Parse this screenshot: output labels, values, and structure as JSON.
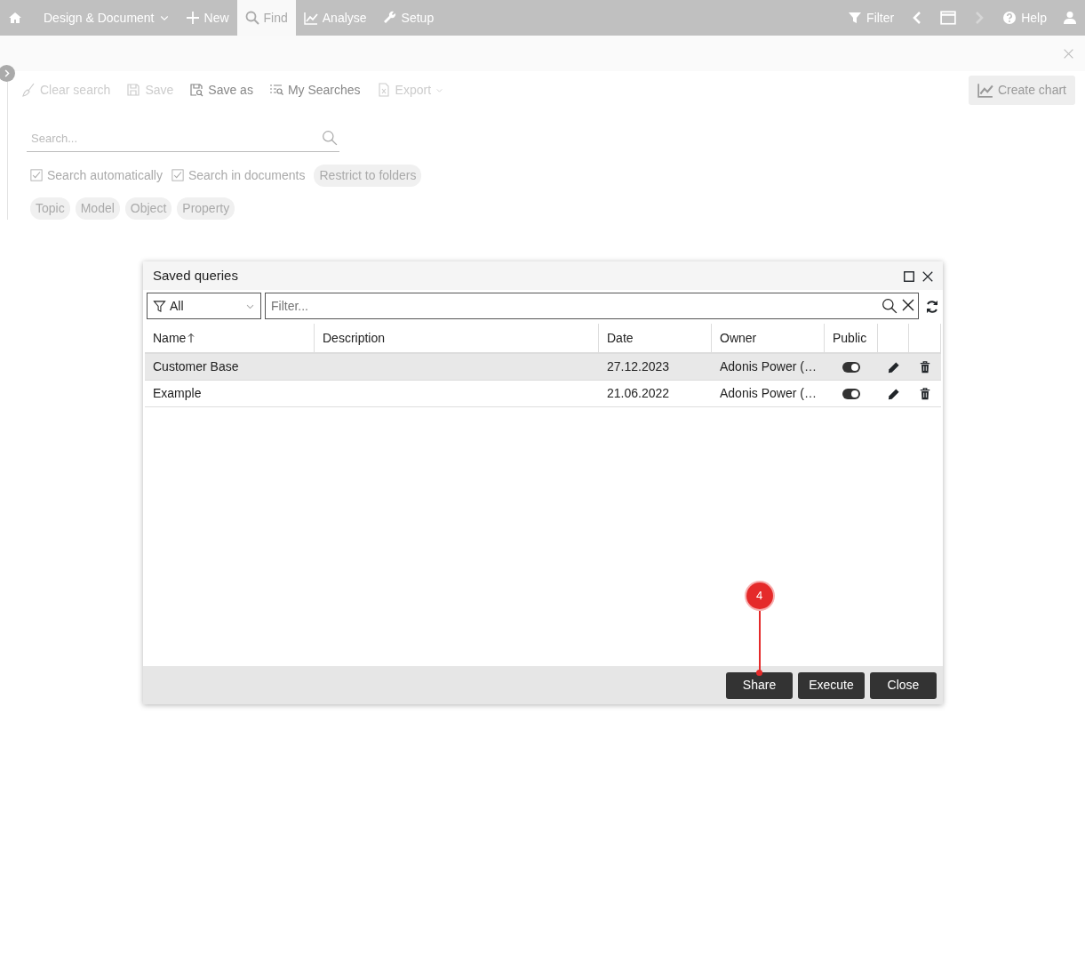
{
  "nav": {
    "left": [
      {
        "kind": "home",
        "dropdown": false,
        "selected": false
      },
      {
        "kind": "text",
        "label": "Design & Document",
        "dropdown": true,
        "selected": false
      },
      {
        "kind": "plus",
        "label": "New",
        "dropdown": false,
        "selected": false
      },
      {
        "kind": "search",
        "label": "Find",
        "dropdown": false,
        "selected": true
      },
      {
        "kind": "chart",
        "label": "Analyse",
        "dropdown": false,
        "selected": false
      },
      {
        "kind": "wrench",
        "label": "Setup",
        "dropdown": false,
        "selected": false
      }
    ],
    "right": [
      {
        "kind": "filter",
        "label": "Filter",
        "disabled": false
      },
      {
        "kind": "back",
        "disabled": false
      },
      {
        "kind": "window",
        "disabled": false
      },
      {
        "kind": "forward",
        "disabled": true
      },
      {
        "kind": "help",
        "label": "Help",
        "disabled": false
      },
      {
        "kind": "user",
        "disabled": false
      }
    ]
  },
  "toolbar": [
    {
      "kind": "broom",
      "label": "Clear search",
      "disabled": true,
      "dropdown": false
    },
    {
      "kind": "save",
      "label": "Save",
      "disabled": true,
      "dropdown": false
    },
    {
      "kind": "saveas",
      "label": "Save as",
      "disabled": false,
      "dropdown": false
    },
    {
      "kind": "list",
      "label": "My Searches",
      "disabled": false,
      "dropdown": false
    },
    {
      "kind": "excel",
      "label": "Export",
      "disabled": true,
      "dropdown": true
    }
  ],
  "create_chart": {
    "label": "Create chart",
    "disabled": true
  },
  "search": {
    "placeholder": "Search..."
  },
  "options": [
    {
      "label": "Search automatically",
      "checked": true
    },
    {
      "label": "Search in documents",
      "checked": true
    }
  ],
  "chips_row1": [
    "Restrict to folders"
  ],
  "chips_row2": [
    "Topic",
    "Model",
    "Object",
    "Property"
  ],
  "dialog": {
    "title": "Saved queries",
    "scope": "All",
    "filter_placeholder": "Filter...",
    "columns": [
      {
        "label": "Name",
        "sorted": true
      },
      {
        "label": "Description",
        "sorted": false
      },
      {
        "label": "Date",
        "sorted": false
      },
      {
        "label": "Owner",
        "sorted": false
      },
      {
        "label": "Public",
        "sorted": false
      }
    ],
    "rows": [
      {
        "name": "Customer Base",
        "date": "27.12.2023",
        "owner": "Adonis Power (…",
        "public": true,
        "selected": true
      },
      {
        "name": "Example",
        "date": "21.06.2022",
        "owner": "Adonis Power (…",
        "public": true,
        "selected": false
      }
    ],
    "buttons": [
      {
        "label": "Share",
        "callout": "4"
      },
      {
        "label": "Execute"
      },
      {
        "label": "Close"
      }
    ]
  }
}
